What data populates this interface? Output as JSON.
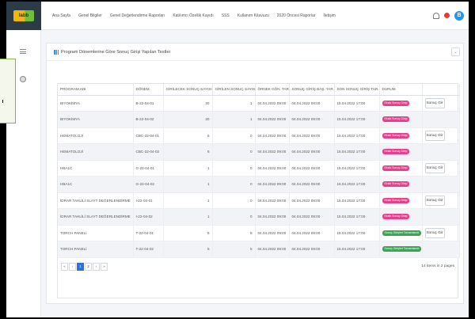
{
  "logo": {
    "text": "labb"
  },
  "nav": [
    "Ana Sayfa",
    "Genel Bilgiler",
    "Genel Değerlendirme Raporları",
    "Katılımcı Özellik Kayıdı",
    "SSS",
    "Kullanım Kılavuzu",
    "2020 Öncesi Raporlar",
    "İletişim"
  ],
  "user": {
    "initial": "B"
  },
  "page": {
    "title": "Program Dönemlerine Göre Sonuç Girişi Yapılan Testler"
  },
  "table": {
    "headers": [
      "PROGRAM ADI",
      "DÖNEM",
      "GİRİLECEK SONUÇ SAYISI",
      "GİRİLEN SONUÇ SAYISI",
      "ÖRNEK GÖN. TAR.",
      "SONUÇ GİRİŞ BAŞ. TAR.",
      "SON SONUÇ GİRİŞ TAR.",
      "DURUM",
      ""
    ],
    "rows": [
      [
        "BIYOKİMYA",
        "B-22-04-01",
        "20",
        "1",
        "04.04.2022 09:00",
        "04.04.2022 09:00",
        "15.04.2022 17:00",
        "Eksik Sonuç Girişi",
        "Sonuç Gir"
      ],
      [
        "BIYOKİMYA",
        "B-22-04-02",
        "20",
        "1",
        "04.04.2022 09:00",
        "04.04.2022 09:00",
        "15.04.2022 17:00",
        "Eksik Sonuç Girişi",
        ""
      ],
      [
        "HEMATOLOJİ",
        "CBC-22-04-01",
        "6",
        "0",
        "04.04.2022 09:00",
        "04.04.2022 09:00",
        "15.04.2022 17:00",
        "Eksik Sonuç Girişi",
        "Sonuç Gir"
      ],
      [
        "HEMATOLOJİ",
        "CBC-22-04-02",
        "6",
        "0",
        "04.04.2022 09:00",
        "04.04.2022 09:00",
        "15.04.2022 17:00",
        "Eksik Sonuç Girişi",
        ""
      ],
      [
        "HBA1C",
        "G-22-04-01",
        "1",
        "0",
        "04.04.2022 09:00",
        "04.04.2022 09:00",
        "15.04.2022 17:00",
        "Eksik Sonuç Girişi",
        "Sonuç Gir"
      ],
      [
        "HBA1C",
        "G-22-04-02",
        "1",
        "0",
        "04.04.2022 09:00",
        "04.04.2022 09:00",
        "15.04.2022 17:00",
        "Eksik Sonuç Girişi",
        ""
      ],
      [
        "İDRAR TAHLİLİ SLAYT DEĞERLENDİRME",
        "I-22-04-01",
        "1",
        "0",
        "04.04.2022 09:00",
        "04.04.2022 09:00",
        "15.04.2022 17:00",
        "Eksik Sonuç Girişi",
        "Sonuç Gir"
      ],
      [
        "İDRAR TAHLİLİ SLAYT DEĞERLENDİRME",
        "I-22-04-02",
        "1",
        "0",
        "04.04.2022 09:00",
        "04.04.2022 09:00",
        "15.04.2022 17:00",
        "Eksik Sonuç Girişi",
        ""
      ],
      [
        "TORCH PANELİ",
        "T-22-04-01",
        "5",
        "5",
        "04.04.2022 09:00",
        "04.04.2022 09:00",
        "15.04.2022 17:00",
        "Sonuç Girişleri Tamamlandı",
        "Sonuç Gir"
      ],
      [
        "TORCH PANELİ",
        "T-22-04-02",
        "5",
        "5",
        "04.04.2022 09:00",
        "04.04.2022 09:00",
        "15.04.2022 17:00",
        "Sonuç Girişleri Tamamlandı",
        ""
      ]
    ]
  },
  "pager": {
    "first": "«",
    "prev": "‹",
    "pages": [
      "1",
      "2"
    ],
    "next": "›",
    "last": "»",
    "info": "14 items in 2 pages"
  },
  "colors": {
    "accent": "#2196f3",
    "danger": "#e53935",
    "badge_incomplete": "#e83e8c",
    "badge_complete": "#3aa655"
  },
  "icons": {
    "menu": "hamburger-menu-icon",
    "disc": "disc-icon",
    "bell": "bell-icon",
    "chart": "bar-chart-icon",
    "collapse": "chevron-down-icon"
  }
}
